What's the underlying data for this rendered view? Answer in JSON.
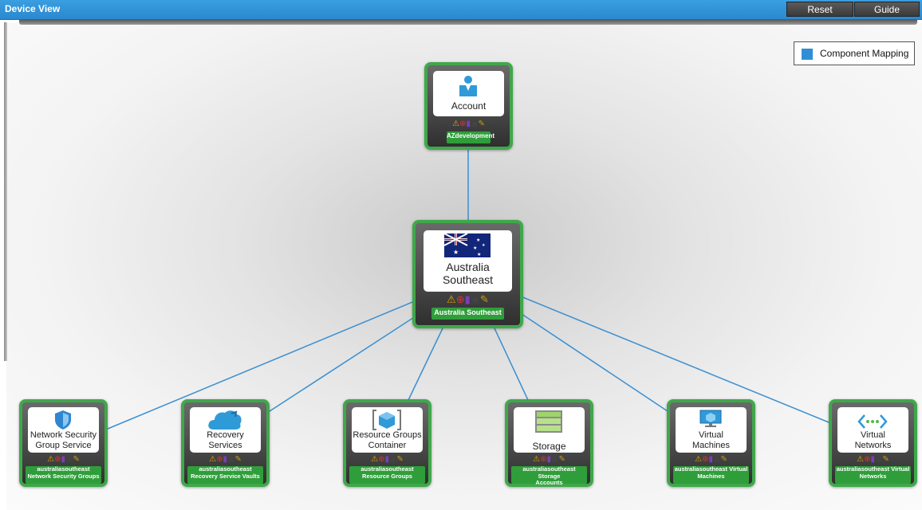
{
  "window": {
    "title": "Device View",
    "reset_label": "Reset",
    "guide_label": "Guide"
  },
  "legend": {
    "label": "Component Mapping",
    "color": "#2f8fd6"
  },
  "colors": {
    "node_border": "#3fa84a",
    "name_bar": "#2f9e3a",
    "link": "#3a8fd0"
  },
  "root": {
    "label": "Account",
    "name": "AZdevelopment",
    "icon": "person-icon"
  },
  "region": {
    "label_line1": "Australia",
    "label_line2": "Southeast",
    "name": "Australia Southeast",
    "icon": "australia-flag-icon"
  },
  "status_icons": [
    "warning-icon",
    "lifebuoy-icon",
    "performance-icon",
    "printer-icon",
    "wrench-icon"
  ],
  "children": [
    {
      "label_line1": "Network Security",
      "label_line2": "Group Service",
      "name_line1": "australiasoutheast",
      "name_line2": "Network Security Groups",
      "icon": "shield-icon"
    },
    {
      "label_line1": "Recovery",
      "label_line2": "Services",
      "name_line1": "australiasoutheast",
      "name_line2": "Recovery Service Vaults",
      "icon": "cloud-icon"
    },
    {
      "label_line1": "Resource Groups",
      "label_line2": "Container",
      "name_line1": "australiasoutheast",
      "name_line2": "Resource Groups",
      "icon": "cube-icon"
    },
    {
      "label_line1": "",
      "label_line2": "Storage",
      "name_line1": "australiasoutheast Storage",
      "name_line2": "Accounts",
      "icon": "storage-icon"
    },
    {
      "label_line1": "Virtual",
      "label_line2": "Machines",
      "name_line1": "australiasoutheast Virtual",
      "name_line2": "Machines",
      "icon": "monitor-icon"
    },
    {
      "label_line1": "Virtual",
      "label_line2": "Networks",
      "name_line1": "australiasoutheast Virtual",
      "name_line2": "Networks",
      "icon": "network-icon"
    }
  ]
}
